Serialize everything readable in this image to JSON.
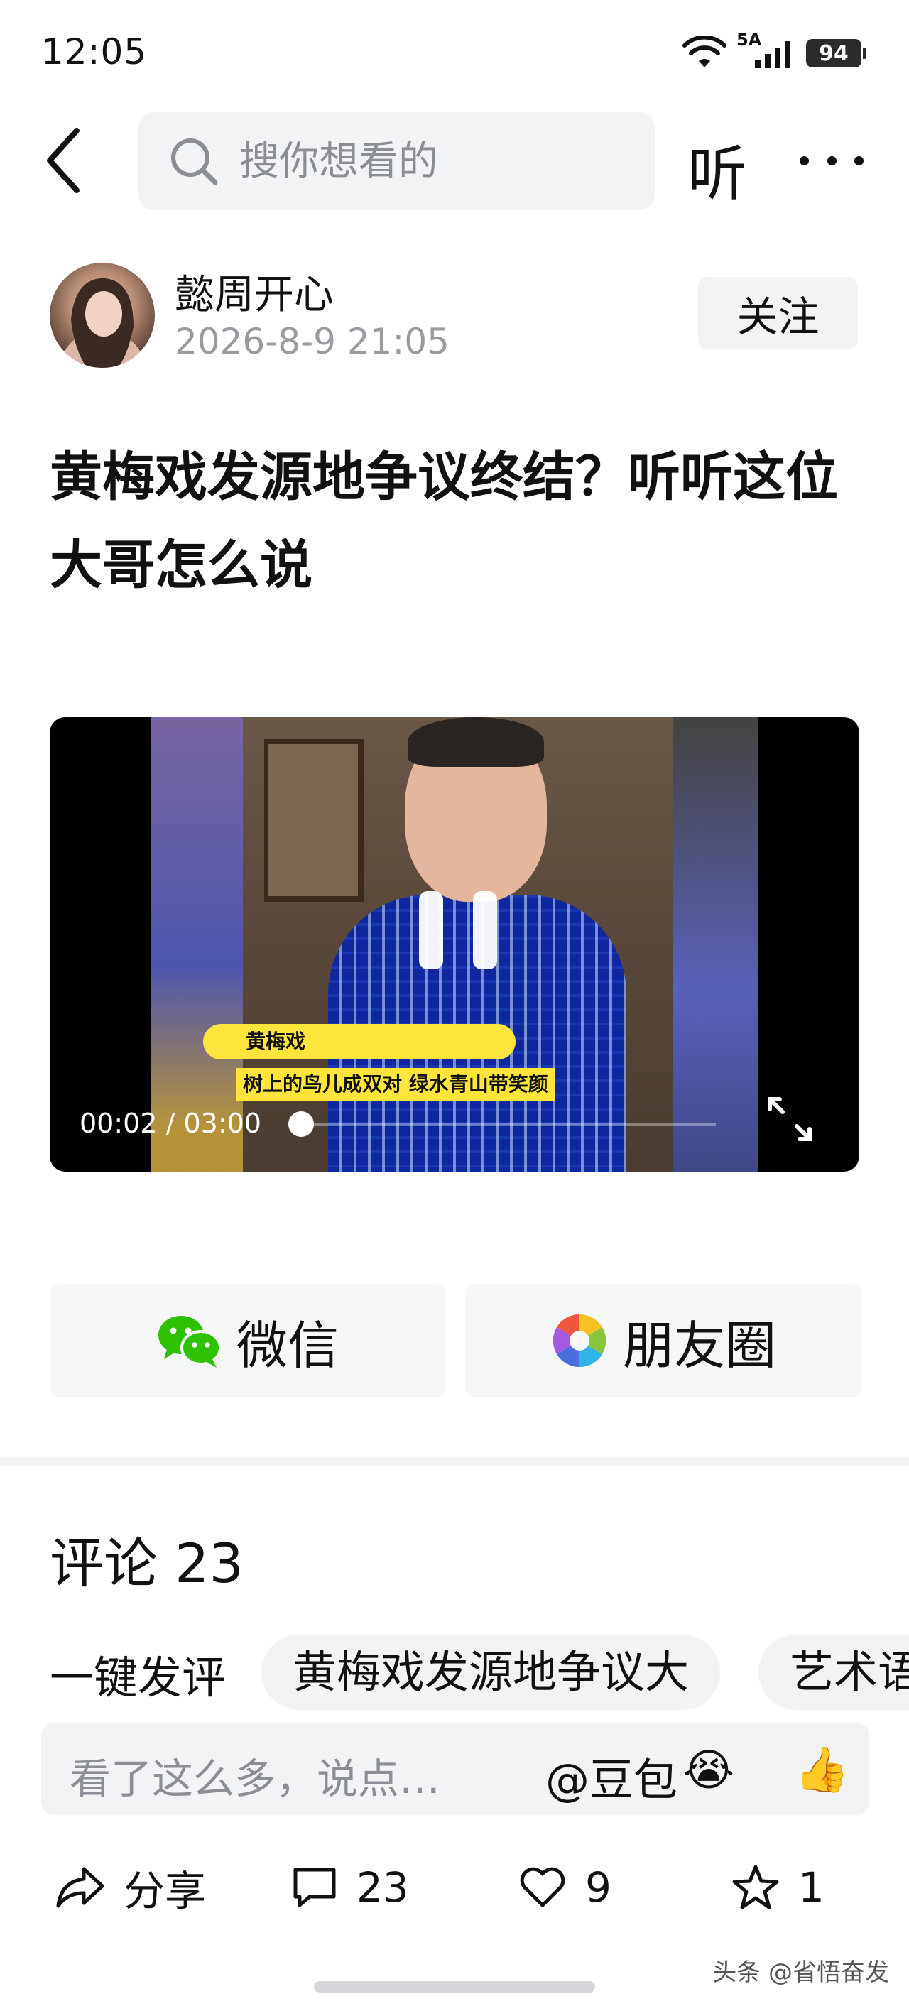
{
  "status": {
    "time": "12:05",
    "network": "5A",
    "battery": "94"
  },
  "nav": {
    "search_placeholder": "搜你想看的",
    "listen_label": "听"
  },
  "author": {
    "name": "懿周开心",
    "time": "2026-8-9  21:05",
    "follow_label": "关注"
  },
  "article": {
    "title": "黄梅戏发源地争议终结？听听这位大哥怎么说"
  },
  "video": {
    "caption_title": "黄梅戏",
    "caption_line": "树上的鸟儿成双对  绿水青山带笑颜",
    "time_display": "00:02 / 03:00",
    "progress": 0.011
  },
  "share": {
    "wechat_label": "微信",
    "moments_label": "朋友圈"
  },
  "comments": {
    "title": "评论 23",
    "quick_label": "一键发评",
    "chips": [
      "黄梅戏发源地争议大",
      "艺术语"
    ],
    "input_placeholder": "看了这么多，说点…",
    "doubao_label": "@豆包",
    "emoji_1": "😭",
    "emoji_2": "👍"
  },
  "actions": {
    "share_label": "分享",
    "comment_count": "23",
    "like_count": "9",
    "fav_count": "1"
  },
  "watermark": "头条 @省悟奋发",
  "colors": {
    "wechat_green": "#2dc100",
    "muted_text": "#999ba0",
    "chip_bg": "#f2f3f5",
    "caption_yellow": "#ffe53b"
  }
}
